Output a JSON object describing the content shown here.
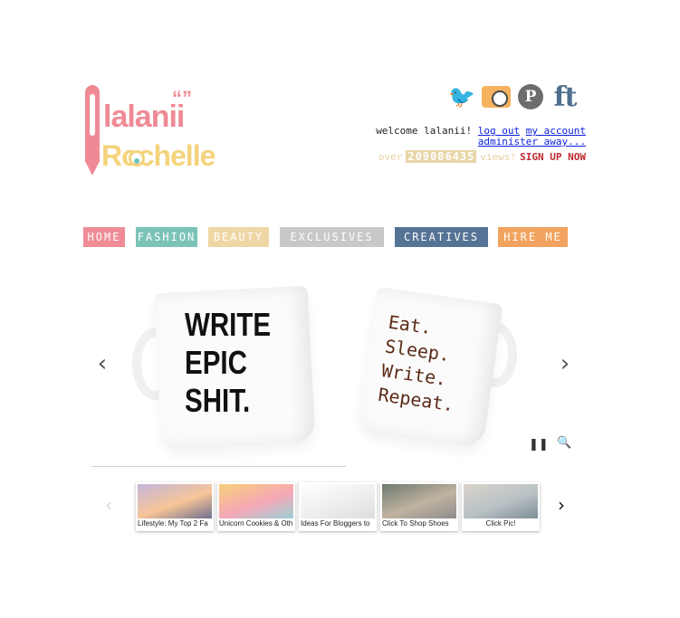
{
  "logo": {
    "line1": "lalanii",
    "quote": "“”",
    "line2": "Rochelle"
  },
  "social": {
    "icons": [
      "twitter-bird-icon",
      "camera-icon",
      "pinterest-icon",
      "facebook-icon",
      "tumblr-icon"
    ],
    "pinterest": "P",
    "ft": "ft"
  },
  "account": {
    "welcome": "welcome lalanii!",
    "logout": "log out",
    "my_account": "my account",
    "administer": "administer away..."
  },
  "views": {
    "prefix": "over",
    "count": "209086435",
    "suffix": "views!",
    "signup": "SIGN UP NOW"
  },
  "nav": [
    {
      "label": "HOME",
      "color": "#ef8c96"
    },
    {
      "label": "FASHION",
      "color": "#7cc3b7"
    },
    {
      "label": "BEAUTY",
      "color": "#efd7a5"
    },
    {
      "label": "EXCLUSIVES",
      "color": "#c8c8c8"
    },
    {
      "label": "CREATIVES",
      "color": "#557395"
    },
    {
      "label": "HIRE ME",
      "color": "#f2a35f"
    }
  ],
  "slider": {
    "mug_left": [
      "WRITE",
      "EPIC",
      "SHIT."
    ],
    "mug_right": [
      "Eat.",
      "Sleep.",
      "Write.",
      "Repeat."
    ],
    "prev": "‹",
    "next": "›",
    "pause": "❚❚",
    "zoom": "🔍"
  },
  "thumbs": [
    {
      "caption": "Lifestyle: My Top 2 Fa",
      "colors": [
        "#c4b6dd",
        "#f7c597",
        "#6f6f8f"
      ]
    },
    {
      "caption": "Unicorn Cookies & Oth",
      "colors": [
        "#f6d07a",
        "#f6a7b6",
        "#9bd2d8"
      ]
    },
    {
      "caption": "Ideas For Bloggers to",
      "colors": [
        "#ffffff",
        "#eeeeee",
        "#dddddd"
      ]
    },
    {
      "caption": "Click To Shop Shoes",
      "colors": [
        "#6e7a70",
        "#c0b2a0",
        "#8c8c8c"
      ]
    },
    {
      "caption": "Click Pic!",
      "colors": [
        "#d9d3cb",
        "#b9c2c5",
        "#7f8d96"
      ]
    }
  ],
  "thumb_arrows": {
    "prev": "‹",
    "next": "›"
  }
}
